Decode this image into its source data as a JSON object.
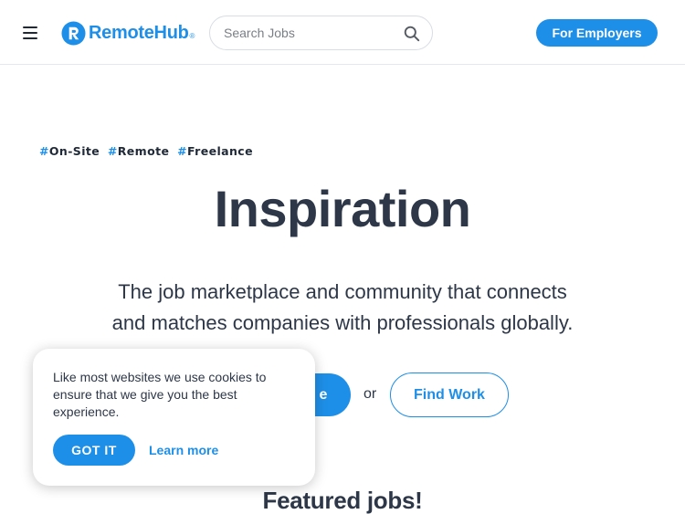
{
  "colors": {
    "brand": "#1e8fe8",
    "text": "#2d3748",
    "border": "#e2e8f0"
  },
  "header": {
    "menu_icon": "hamburger-icon",
    "logo_text": "RemoteHub",
    "logo_reg": "®",
    "search": {
      "placeholder": "Search Jobs",
      "value": "",
      "icon": "search-icon"
    },
    "employers_label": "For Employers"
  },
  "hero": {
    "tags": [
      {
        "hash": "#",
        "label": "On-Site"
      },
      {
        "hash": "#",
        "label": "Remote"
      },
      {
        "hash": "#",
        "label": "Freelance"
      }
    ],
    "title": "Inspiration",
    "subtitle_line1": "The job marketplace and community that connects",
    "subtitle_line2": "and matches companies with professionals globally.",
    "cta_primary_visible": "e",
    "cta_or": "or",
    "cta_secondary": "Find Work"
  },
  "featured_title": "Featured jobs!",
  "cookie": {
    "text": "Like most websites we use cookies to ensure that we give you the best experience.",
    "accept_label": "GOT IT",
    "learn_label": "Learn more"
  }
}
